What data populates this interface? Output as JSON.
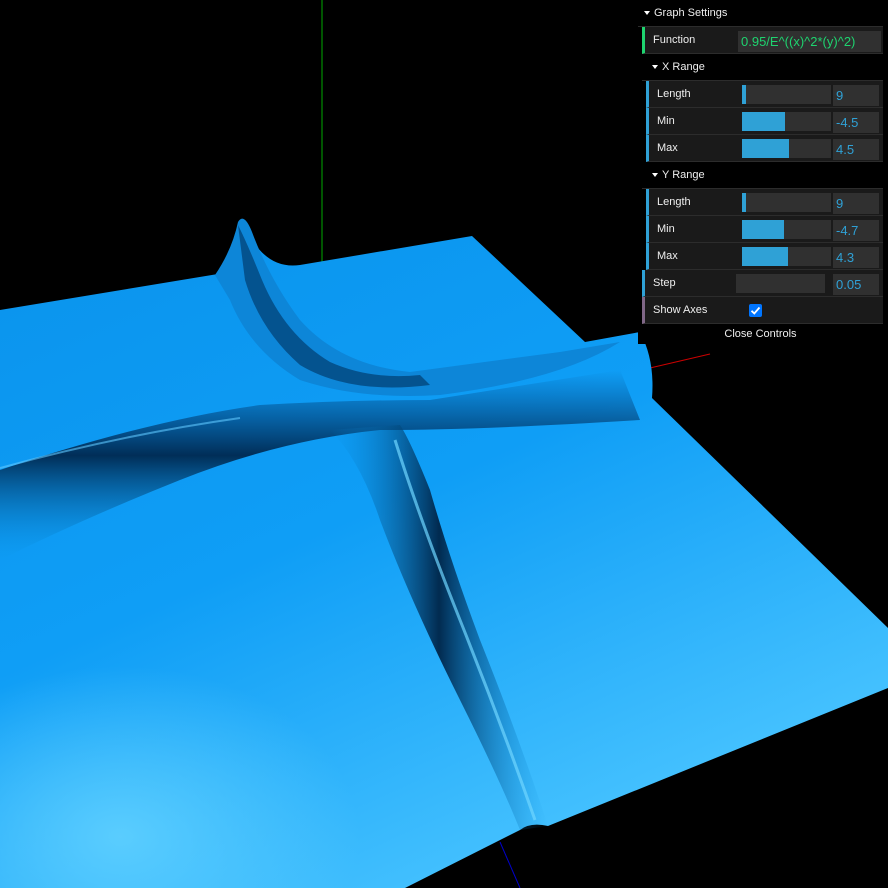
{
  "graph_settings": {
    "title": "Graph Settings",
    "function_label": "Function",
    "function_value": "0.95/E^((x)^2*(y)^2)",
    "x_range": {
      "title": "X Range",
      "length": {
        "label": "Length",
        "value": "9",
        "fraction": 0.04
      },
      "min": {
        "label": "Min",
        "value": "-4.5",
        "fraction": 0.48
      },
      "max": {
        "label": "Max",
        "value": "4.5",
        "fraction": 0.53
      }
    },
    "y_range": {
      "title": "Y Range",
      "length": {
        "label": "Length",
        "value": "9",
        "fraction": 0.04
      },
      "min": {
        "label": "Min",
        "value": "-4.7",
        "fraction": 0.47
      },
      "max": {
        "label": "Max",
        "value": "4.3",
        "fraction": 0.52
      }
    },
    "step": {
      "label": "Step",
      "value": "0.05",
      "fraction": 0.0
    },
    "show_axes": {
      "label": "Show Axes",
      "checked": true
    },
    "close_label": "Close Controls"
  },
  "colors": {
    "surface": "#0099ff",
    "surface_dark": "#002a55",
    "axis_x": "#cc0000",
    "axis_y": "#00aa00",
    "axis_z": "#0000cc",
    "slider_fill": "#2fa1d6",
    "string_accent": "#1ed36f"
  }
}
